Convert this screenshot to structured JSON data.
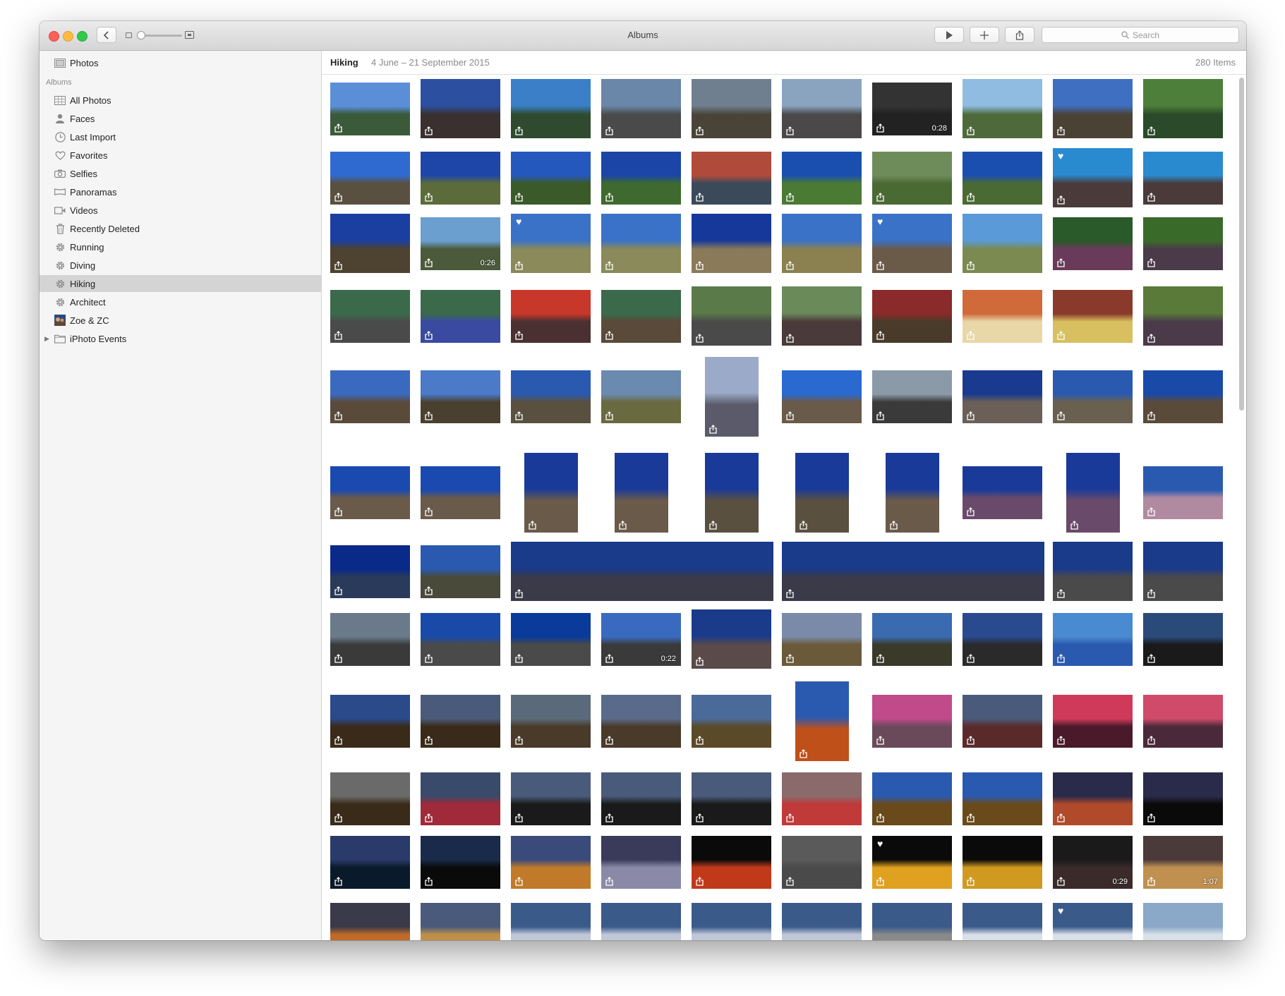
{
  "window": {
    "title": "Albums"
  },
  "toolbar": {
    "search_placeholder": "Search"
  },
  "sidebar": {
    "top_item": "Photos",
    "section_header": "Albums",
    "items": [
      {
        "label": "All Photos",
        "icon": "all-photos-icon"
      },
      {
        "label": "Faces",
        "icon": "faces-icon"
      },
      {
        "label": "Last Import",
        "icon": "clock-icon"
      },
      {
        "label": "Favorites",
        "icon": "heart-icon"
      },
      {
        "label": "Selfies",
        "icon": "camera-icon"
      },
      {
        "label": "Panoramas",
        "icon": "panorama-icon"
      },
      {
        "label": "Videos",
        "icon": "video-icon"
      },
      {
        "label": "Recently Deleted",
        "icon": "trash-icon"
      },
      {
        "label": "Running",
        "icon": "gear-icon"
      },
      {
        "label": "Diving",
        "icon": "gear-icon"
      },
      {
        "label": "Hiking",
        "icon": "gear-icon",
        "selected": true
      },
      {
        "label": "Architect",
        "icon": "gear-icon"
      },
      {
        "label": "Zoe & ZC",
        "icon": "album-thumbnail-icon"
      },
      {
        "label": "iPhoto Events",
        "icon": "folder-icon"
      }
    ]
  },
  "main": {
    "album_title": "Hiking",
    "album_dates": "4 June – 21 September 2015",
    "item_count": "280 Items"
  },
  "photos": {
    "rows": [
      [
        {
          "c": [
            "#5a8fd8",
            "#3b5a3a"
          ],
          "o": "l"
        },
        {
          "c": [
            "#2d4fa0",
            "#3a3030"
          ],
          "o": "s"
        },
        {
          "c": [
            "#3a7fc7",
            "#2f4a2e"
          ],
          "o": "s"
        },
        {
          "c": [
            "#6a86a8",
            "#4a4a4a"
          ],
          "o": "s"
        },
        {
          "c": [
            "#6f7f8f",
            "#4a4438"
          ],
          "o": "s"
        },
        {
          "c": [
            "#8aa4c0",
            "#4a4848"
          ],
          "o": "s"
        },
        {
          "c": [
            "#333",
            "#222"
          ],
          "o": "l",
          "d": "0:28"
        },
        {
          "c": [
            "#8fbce0",
            "#4e6a3a"
          ],
          "o": "s"
        },
        {
          "c": [
            "#3f6fc0",
            "#4b4236"
          ],
          "o": "s"
        },
        {
          "c": [
            "#4d7f3a",
            "#2a4a2a"
          ],
          "o": "s"
        }
      ],
      [
        {
          "c": [
            "#2f6ad0",
            "#5a5040"
          ],
          "o": "l"
        },
        {
          "c": [
            "#1e46a8",
            "#5b6b3a"
          ],
          "o": "l"
        },
        {
          "c": [
            "#2458bc",
            "#3a5a2a"
          ],
          "o": "l"
        },
        {
          "c": [
            "#1b46a8",
            "#3f6a2f"
          ],
          "o": "l"
        },
        {
          "c": [
            "#b04a3a",
            "#3a4a5a"
          ],
          "o": "l"
        },
        {
          "c": [
            "#1a4fb0",
            "#4a7a34"
          ],
          "o": "l"
        },
        {
          "c": [
            "#6e8c5a",
            "#4a6a34"
          ],
          "o": "l"
        },
        {
          "c": [
            "#1a4fb0",
            "#4a6a34"
          ],
          "o": "l"
        },
        {
          "c": [
            "#2a8ad0",
            "#4a3a3a"
          ],
          "o": "s",
          "h": true
        },
        {
          "c": [
            "#2a8ad0",
            "#4a3a3a"
          ],
          "o": "l"
        }
      ],
      [
        {
          "c": [
            "#1b3fa0",
            "#4e4230"
          ],
          "o": "s"
        },
        {
          "c": [
            "#6a9fd0",
            "#4a5a3a"
          ],
          "o": "l",
          "d": "0:26"
        },
        {
          "c": [
            "#3a72c8",
            "#8a8a5a"
          ],
          "o": "s",
          "h": true
        },
        {
          "c": [
            "#3a72c8",
            "#8a8a5a"
          ],
          "o": "s"
        },
        {
          "c": [
            "#16389a",
            "#8a7a5a"
          ],
          "o": "s"
        },
        {
          "c": [
            "#3a72c8",
            "#8a8050"
          ],
          "o": "s"
        },
        {
          "c": [
            "#3a72c8",
            "#6a5a48"
          ],
          "o": "s",
          "h": true
        },
        {
          "c": [
            "#5a9ad8",
            "#7a8a50"
          ],
          "o": "s"
        },
        {
          "c": [
            "#2a5a2a",
            "#6a3a5a"
          ],
          "o": "l"
        },
        {
          "c": [
            "#3a6a2a",
            "#4a3a4a"
          ],
          "o": "l"
        }
      ],
      [
        {
          "c": [
            "#3a6a4a",
            "#4a4a4a"
          ],
          "o": "l"
        },
        {
          "c": [
            "#3a6a4a",
            "#3a4aa0"
          ],
          "o": "l"
        },
        {
          "c": [
            "#c8382a",
            "#4a3030"
          ],
          "o": "l"
        },
        {
          "c": [
            "#3a6a4a",
            "#5a4a3a"
          ],
          "o": "l"
        },
        {
          "c": [
            "#5a7a4a",
            "#4a4a4a"
          ],
          "o": "s"
        },
        {
          "c": [
            "#6a8a5a",
            "#4a3a3a"
          ],
          "o": "s"
        },
        {
          "c": [
            "#8a2a2a",
            "#4a3a2a"
          ],
          "o": "l"
        },
        {
          "c": [
            "#d06a3a",
            "#e8d8a8"
          ],
          "o": "l"
        },
        {
          "c": [
            "#8a3a2a",
            "#d8c060"
          ],
          "o": "l"
        },
        {
          "c": [
            "#5a7a3a",
            "#4a3a4a"
          ],
          "o": "s"
        }
      ],
      [
        {
          "c": [
            "#3a6ac0",
            "#5a4a3a"
          ],
          "o": "l"
        },
        {
          "c": [
            "#4a7ac8",
            "#4a4030"
          ],
          "o": "l"
        },
        {
          "c": [
            "#2a5ab0",
            "#5a5040"
          ],
          "o": "l"
        },
        {
          "c": [
            "#6a8ab0",
            "#6a6a40"
          ],
          "o": "l"
        },
        {
          "c": [
            "#9aaac8",
            "#5a5a6a"
          ],
          "o": "p"
        },
        {
          "c": [
            "#2a6ad0",
            "#6a5a4a"
          ],
          "o": "l"
        },
        {
          "c": [
            "#8a9aa8",
            "#3a3a3a"
          ],
          "o": "l"
        },
        {
          "c": [
            "#1a3a90",
            "#6a6058"
          ],
          "o": "l"
        },
        {
          "c": [
            "#2a5ab0",
            "#6a6050"
          ],
          "o": "l"
        },
        {
          "c": [
            "#1a4aa8",
            "#5a4a3a"
          ],
          "o": "l"
        }
      ],
      [
        {
          "c": [
            "#1a4ab0",
            "#6a5a4a"
          ],
          "o": "l"
        },
        {
          "c": [
            "#1a4ab0",
            "#6a5a4a"
          ],
          "o": "l"
        },
        {
          "c": [
            "#1a3a9a",
            "#6a5a4a"
          ],
          "o": "p"
        },
        {
          "c": [
            "#1a3a9a",
            "#6a5a4a"
          ],
          "o": "p"
        },
        {
          "c": [
            "#1a3a9a",
            "#5a5040"
          ],
          "o": "p"
        },
        {
          "c": [
            "#1a3a9a",
            "#5a5040"
          ],
          "o": "p"
        },
        {
          "c": [
            "#1a3a9a",
            "#6a5a4a"
          ],
          "o": "p"
        },
        {
          "c": [
            "#1a3a9a",
            "#6a4a6a"
          ],
          "o": "l"
        },
        {
          "c": [
            "#1a3a9a",
            "#6a4a6a"
          ],
          "o": "p"
        },
        {
          "c": [
            "#2a5ab0",
            "#b08aa0"
          ],
          "o": "l"
        }
      ],
      [
        {
          "c": [
            "#0a2a8a",
            "#2a3a5a"
          ],
          "o": "l"
        },
        {
          "c": [
            "#2a5ab0",
            "#4a4a3a"
          ],
          "o": "l"
        },
        {
          "c": [
            "#1a3a8a",
            "#3a3a48"
          ],
          "o": "w"
        },
        {
          "c": [
            "#1a3a8a",
            "#3a3a48"
          ],
          "o": "w"
        },
        {
          "c": [
            "#1a3a8a",
            "#4a4a4a"
          ],
          "o": "s"
        },
        {
          "c": [
            "#1a3a8a",
            "#4a4a4a"
          ],
          "o": "s"
        }
      ],
      [
        {
          "c": [
            "#6a7a8a",
            "#3a3a3a"
          ],
          "o": "l"
        },
        {
          "c": [
            "#1a4aa8",
            "#4a4a4a"
          ],
          "o": "l"
        },
        {
          "c": [
            "#0a3a9a",
            "#4a4a4a"
          ],
          "o": "l"
        },
        {
          "c": [
            "#3a6ac0",
            "#3a3a3a"
          ],
          "o": "l",
          "d": "0:22"
        },
        {
          "c": [
            "#1a3a8a",
            "#5a4a4a"
          ],
          "o": "s"
        },
        {
          "c": [
            "#7a8aa8",
            "#6a5a3a"
          ],
          "o": "l"
        },
        {
          "c": [
            "#3a6ab0",
            "#3a3a2a"
          ],
          "o": "l"
        },
        {
          "c": [
            "#2a4a90",
            "#2a2a2a"
          ],
          "o": "l"
        },
        {
          "c": [
            "#4a8ad0",
            "#2a5ab0"
          ],
          "o": "l"
        },
        {
          "c": [
            "#2a4a7a",
            "#1a1a1a"
          ],
          "o": "l"
        }
      ],
      [
        {
          "c": [
            "#2a4a8a",
            "#3a2a1a"
          ],
          "o": "l"
        },
        {
          "c": [
            "#4a5a7a",
            "#3a2a1a"
          ],
          "o": "l"
        },
        {
          "c": [
            "#5a6a7a",
            "#4a3a2a"
          ],
          "o": "l"
        },
        {
          "c": [
            "#5a6a8a",
            "#4a3a2a"
          ],
          "o": "l"
        },
        {
          "c": [
            "#4a6a9a",
            "#5a4a2a"
          ],
          "o": "l"
        },
        {
          "c": [
            "#2a5ab0",
            "#c0501a"
          ],
          "o": "p"
        },
        {
          "c": [
            "#c04a8a",
            "#6a4a5a"
          ],
          "o": "l"
        },
        {
          "c": [
            "#4a5a7a",
            "#5a2a2a"
          ],
          "o": "l"
        },
        {
          "c": [
            "#d03a5a",
            "#4a1a2a"
          ],
          "o": "l"
        },
        {
          "c": [
            "#d04a6a",
            "#4a2a3a"
          ],
          "o": "l"
        }
      ],
      [
        {
          "c": [
            "#6a6a6a",
            "#3a2a1a"
          ],
          "o": "l"
        },
        {
          "c": [
            "#3a4a6a",
            "#a02a3a"
          ],
          "o": "l"
        },
        {
          "c": [
            "#4a5a7a",
            "#1a1a1a"
          ],
          "o": "l"
        },
        {
          "c": [
            "#4a5a7a",
            "#1a1a1a"
          ],
          "o": "l"
        },
        {
          "c": [
            "#4a5a7a",
            "#1a1a1a"
          ],
          "o": "l"
        },
        {
          "c": [
            "#8a6a6a",
            "#c03a3a"
          ],
          "o": "l"
        },
        {
          "c": [
            "#2a5ab0",
            "#6a4a1a"
          ],
          "o": "l"
        },
        {
          "c": [
            "#2a5ab0",
            "#6a4a1a"
          ],
          "o": "l"
        },
        {
          "c": [
            "#2a2a4a",
            "#b04a2a"
          ],
          "o": "l"
        },
        {
          "c": [
            "#2a2a4a",
            "#0a0a0a"
          ],
          "o": "l"
        }
      ],
      [
        {
          "c": [
            "#2a3a6a",
            "#0a1a2a"
          ],
          "o": "l"
        },
        {
          "c": [
            "#1a2a4a",
            "#0a0a0a"
          ],
          "o": "l"
        },
        {
          "c": [
            "#3a4a7a",
            "#c07a2a"
          ],
          "o": "l"
        },
        {
          "c": [
            "#3a3a5a",
            "#8a8aa8"
          ],
          "o": "l"
        },
        {
          "c": [
            "#0a0a0a",
            "#c03a1a"
          ],
          "o": "l"
        },
        {
          "c": [
            "#5a5a5a",
            "#4a4a4a"
          ],
          "o": "l"
        },
        {
          "c": [
            "#0a0a0a",
            "#e0a020"
          ],
          "o": "l",
          "h": true
        },
        {
          "c": [
            "#0a0a0a",
            "#d09a20"
          ],
          "o": "l"
        },
        {
          "c": [
            "#1a1a1a",
            "#3a2a2a"
          ],
          "o": "l",
          "d": "0:29"
        },
        {
          "c": [
            "#4a3a3a",
            "#c09050"
          ],
          "o": "l",
          "d": "1:07"
        }
      ],
      [
        {
          "c": [
            "#3a3a4a",
            "#c06a2a"
          ],
          "o": "l"
        },
        {
          "c": [
            "#4a5a7a",
            "#c0904a"
          ],
          "o": "l"
        },
        {
          "c": [
            "#3a5a8a",
            "#c0c8d8"
          ],
          "o": "l"
        },
        {
          "c": [
            "#3a5a8a",
            "#c0c8d8"
          ],
          "o": "l"
        },
        {
          "c": [
            "#3a5a8a",
            "#c0c8d8"
          ],
          "o": "l"
        },
        {
          "c": [
            "#3a5a8a",
            "#c0c8d8"
          ],
          "o": "l"
        },
        {
          "c": [
            "#3a5a8a",
            "#8a8a8a"
          ],
          "o": "l"
        },
        {
          "c": [
            "#3a5a8a",
            "#d8e0e8"
          ],
          "o": "l"
        },
        {
          "c": [
            "#3a5a8a",
            "#d8e0e8"
          ],
          "o": "l",
          "h": true
        },
        {
          "c": [
            "#8aa8c8",
            "#d8e0e8"
          ],
          "o": "l"
        }
      ]
    ]
  }
}
